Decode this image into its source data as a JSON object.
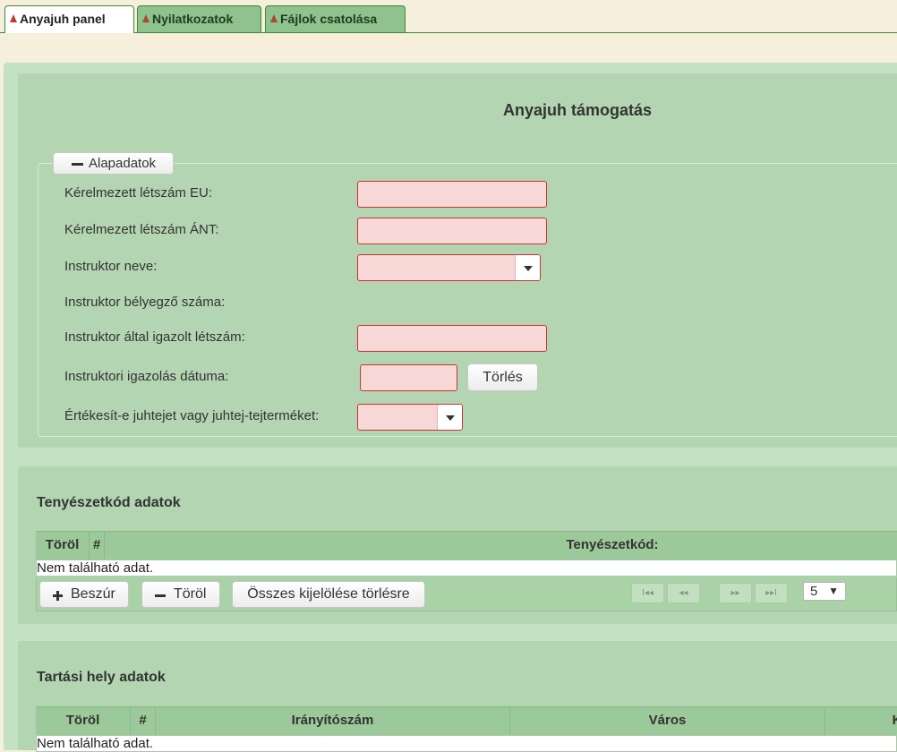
{
  "tabs": [
    {
      "label": "Anyajuh panel"
    },
    {
      "label": "Nyilatkozatok"
    },
    {
      "label": "Fájlok csatolása"
    }
  ],
  "main": {
    "title": "Anyajuh támogatás",
    "basic_section": {
      "legend": "Alapadatok",
      "fields": {
        "eu_count_label": "Kérelmezett létszám EU:",
        "ant_count_label": "Kérelmezett létszám ÁNT:",
        "instructor_name_label": "Instruktor neve:",
        "instructor_stamp_label": "Instruktor bélyegző száma:",
        "instructor_certified_label": "Instruktor által igazolt létszám:",
        "instructor_cert_date_label": "Instruktori igazolás dátuma:",
        "sells_milk_label": "Értékesít-e juhtejet vagy juhtej-tejterméket:"
      },
      "clear_button": "Törlés"
    }
  },
  "holding_table": {
    "title": "Tenyészetkód adatok",
    "columns": [
      "Töröl",
      "#",
      "Tenyészetkód:"
    ],
    "empty_text": "Nem található adat.",
    "buttons": {
      "insert": "Beszúr",
      "delete": "Töröl",
      "clear_selection": "Összes kijelölése törlésre"
    },
    "pager": {
      "first": "I◂◂",
      "prev": "◂◂",
      "next": "▸▸",
      "last": "▸▸I",
      "page_size": "5"
    }
  },
  "location_table": {
    "title": "Tartási hely adatok",
    "columns": [
      "Töröl",
      "#",
      "Irányítószám",
      "Város",
      "K"
    ],
    "empty_text": "Nem található adat."
  },
  "colors": {
    "accent": "#3d8a3a",
    "error_bg": "#f8d7d7",
    "error_border": "#cc3333",
    "panel": "#b3d5b1"
  }
}
